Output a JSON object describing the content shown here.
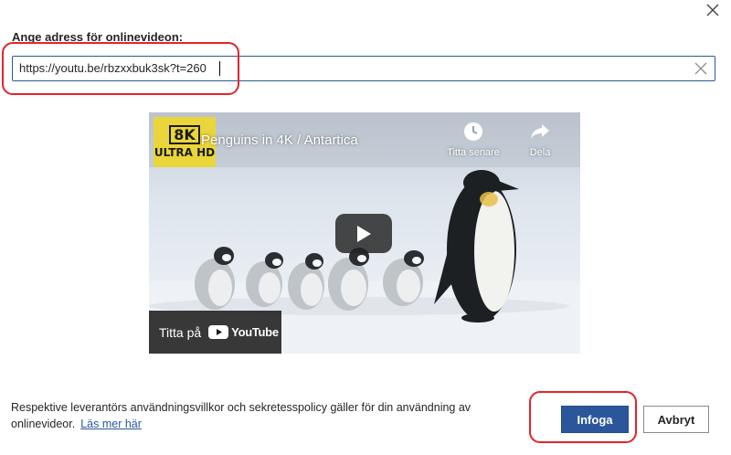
{
  "dialog": {
    "url_label": "Ange adress för onlinevideon:",
    "url_value": "https://youtu.be/rbzxxbuk3sk?t=260",
    "disclaimer_text": "Respektive leverantörs användningsvillkor och sekretesspolicy gäller för din användning av onlinevideor.",
    "learn_more": "Läs mer här",
    "insert_label": "Infoga",
    "cancel_label": "Avbryt"
  },
  "video": {
    "title": "Penguins in 4K / Antartica",
    "channel_logo_line1": "8K",
    "channel_logo_line2": "ULTRA HD",
    "watch_later": "Titta senare",
    "share": "Dela",
    "watch_on": "Titta på",
    "youtube_wordmark": "YouTube"
  },
  "icons": {
    "close": "close-icon",
    "clear": "clear-icon",
    "clock": "clock-icon",
    "share": "share-icon",
    "play": "play-icon",
    "youtube": "youtube-logo-icon"
  },
  "colors": {
    "accent": "#2b579a",
    "highlight": "#e3242b",
    "logo_yellow": "#ead53a",
    "youtube_red": "#ff0000"
  }
}
